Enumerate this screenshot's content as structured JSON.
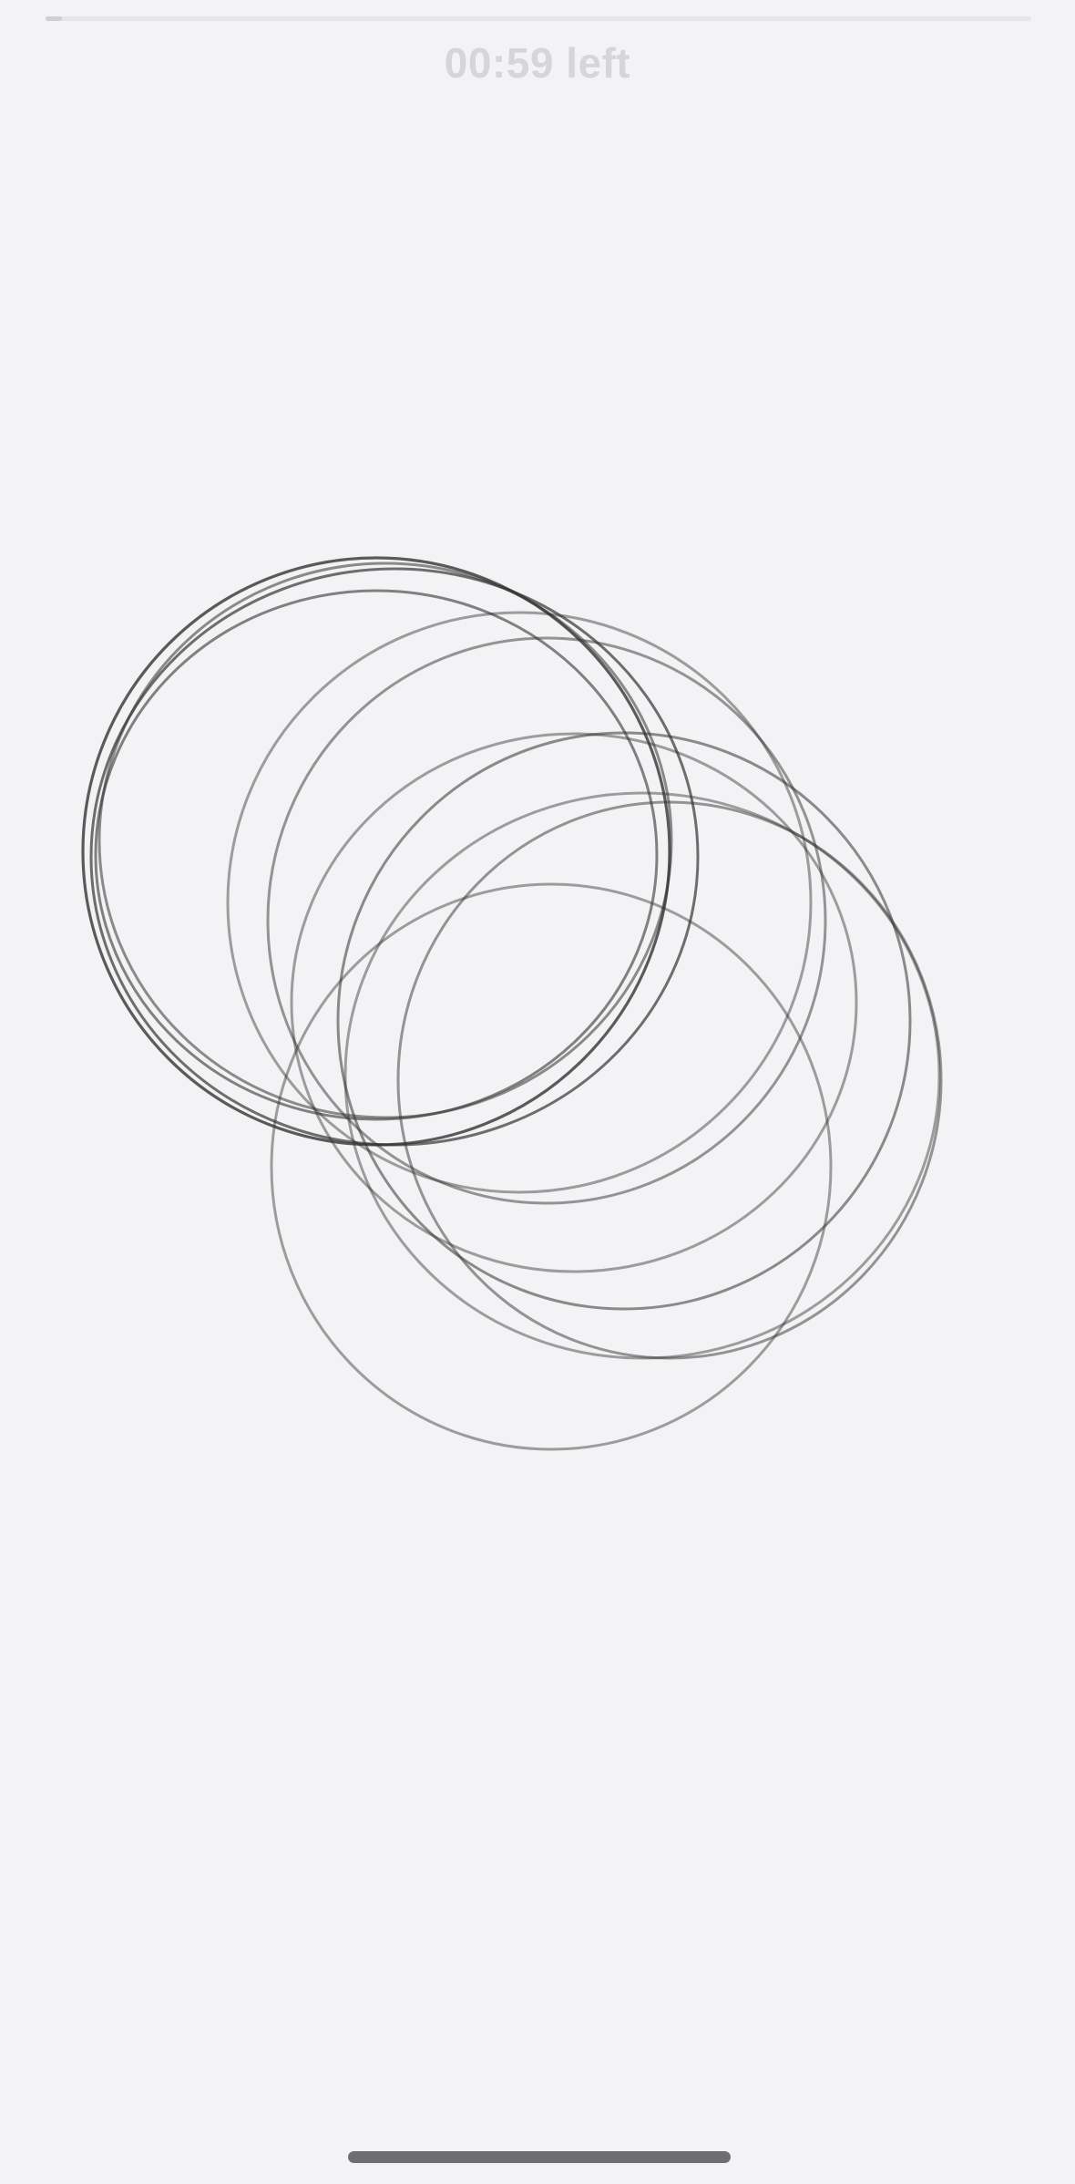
{
  "timer": {
    "label": "00:59 left",
    "progress_fraction": 0.017
  },
  "colors": {
    "background": "#f3f3f5",
    "track": "#e6e6e9",
    "fill": "#cfcfd3",
    "timer_text": "#d6d6d9",
    "stroke": "#333333",
    "home_indicator": "#6e6e72"
  }
}
